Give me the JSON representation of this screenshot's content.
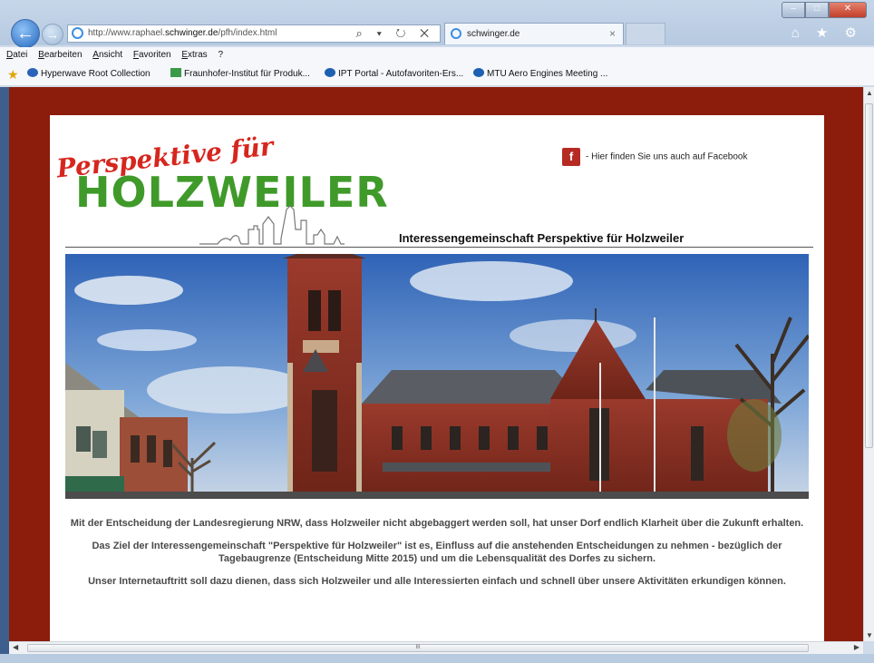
{
  "browser": {
    "address_url_prefix": "http://www.raphael.",
    "address_url_domain": "schwinger.de",
    "address_url_path": "/pfh/index.html",
    "address_tools": "⌕ ▾ ↻ ✕",
    "tab_title": "schwinger.de",
    "tab_close": "×",
    "right_tools": "⌂ ★ ⚙",
    "menu": [
      "Datei",
      "Bearbeiten",
      "Ansicht",
      "Favoriten",
      "Extras",
      "?"
    ],
    "favorites": [
      {
        "label": "Hyperwave Root Collection",
        "color": "#2b62b8"
      },
      {
        "label": "Fraunhofer-Institut für Produk...",
        "color": "#3a9a4a"
      },
      {
        "label": "IPT Portal - Autofavoriten-Ers...",
        "color": "#1d5fb0"
      },
      {
        "label": "MTU Aero Engines Meeting ...",
        "color": "#1d5fb0"
      }
    ],
    "hscroll_grip": "III"
  },
  "page": {
    "facebook_icon": "f",
    "facebook_text": "- Hier finden Sie uns auch auf Facebook",
    "logo_top": "Perspektive für",
    "logo_main": "HOLZWEILER",
    "tagline": "Interessengemeinschaft Perspektive für Holzweiler",
    "paragraphs": [
      "Mit der Entscheidung der Landesregierung NRW, dass Holzweiler nicht abgebaggert werden soll, hat unser Dorf endlich Klarheit über die Zukunft erhalten.",
      "Das Ziel der Interessengemeinschaft \"Perspektive für Holzweiler\" ist es, Einfluss auf die anstehenden Entscheidungen zu nehmen - bezüglich der Tagebaugrenze (Entscheidung Mitte 2015) und um die Lebensqualität des Dorfes zu sichern.",
      "Unser Internetauftritt soll dazu dienen, dass sich Holzweiler und alle Interessierten einfach und schnell über unsere Aktivitäten erkundigen können."
    ]
  },
  "colors": {
    "page_background": "#8c1c0b",
    "logo_red": "#d6261e",
    "logo_green": "#3f9a2a"
  }
}
